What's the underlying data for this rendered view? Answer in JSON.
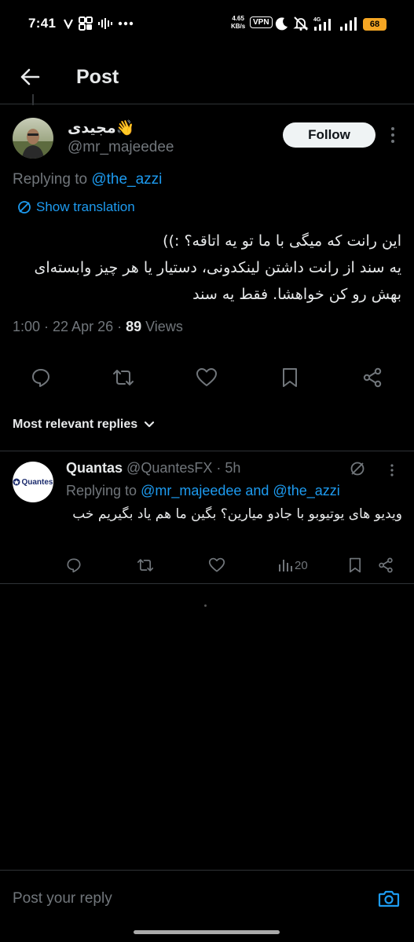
{
  "status_bar": {
    "time": "7:41",
    "net_speed_value": "4.65",
    "net_speed_unit": "KB/s",
    "vpn": "VPN",
    "network": "4G",
    "battery": "68"
  },
  "header": {
    "title": "Post"
  },
  "post": {
    "author_name": "مجیدی👋",
    "author_handle": "@mr_majeedee",
    "follow_label": "Follow",
    "replying_prefix": "Replying to ",
    "replying_handle": "@the_azzi",
    "show_translation": "Show translation",
    "text": "این رانت که میگی با ما تو یه اتاقه؟ :))\nیه سند از رانت داشتن لینکدونی، دستیار یا هر چیز وابسته‌ای بهش رو کن خواهشا. فقط یه سند",
    "timestamp": "1:00 · 22 Apr 26 · ",
    "views_count": "89",
    "views_label": " Views"
  },
  "replies_sort": {
    "label": "Most relevant replies"
  },
  "reply": {
    "avatar_text": "Quantes",
    "name": "Quantas",
    "handle": "@QuantesFX",
    "time": " · 5h",
    "replying_prefix": "Replying to ",
    "replying_handles": "@mr_majeedee and @the_azzi",
    "text": "ویدیو های یوتیوبو با جادو میارین؟ بگین ما هم یاد بگیریم خب",
    "views": "20"
  },
  "composer": {
    "placeholder": "Post your reply"
  },
  "colors": {
    "background": "#000000",
    "text": "#e7e9ea",
    "muted": "#71767b",
    "accent": "#1d9bf0",
    "battery": "#f5a623"
  }
}
